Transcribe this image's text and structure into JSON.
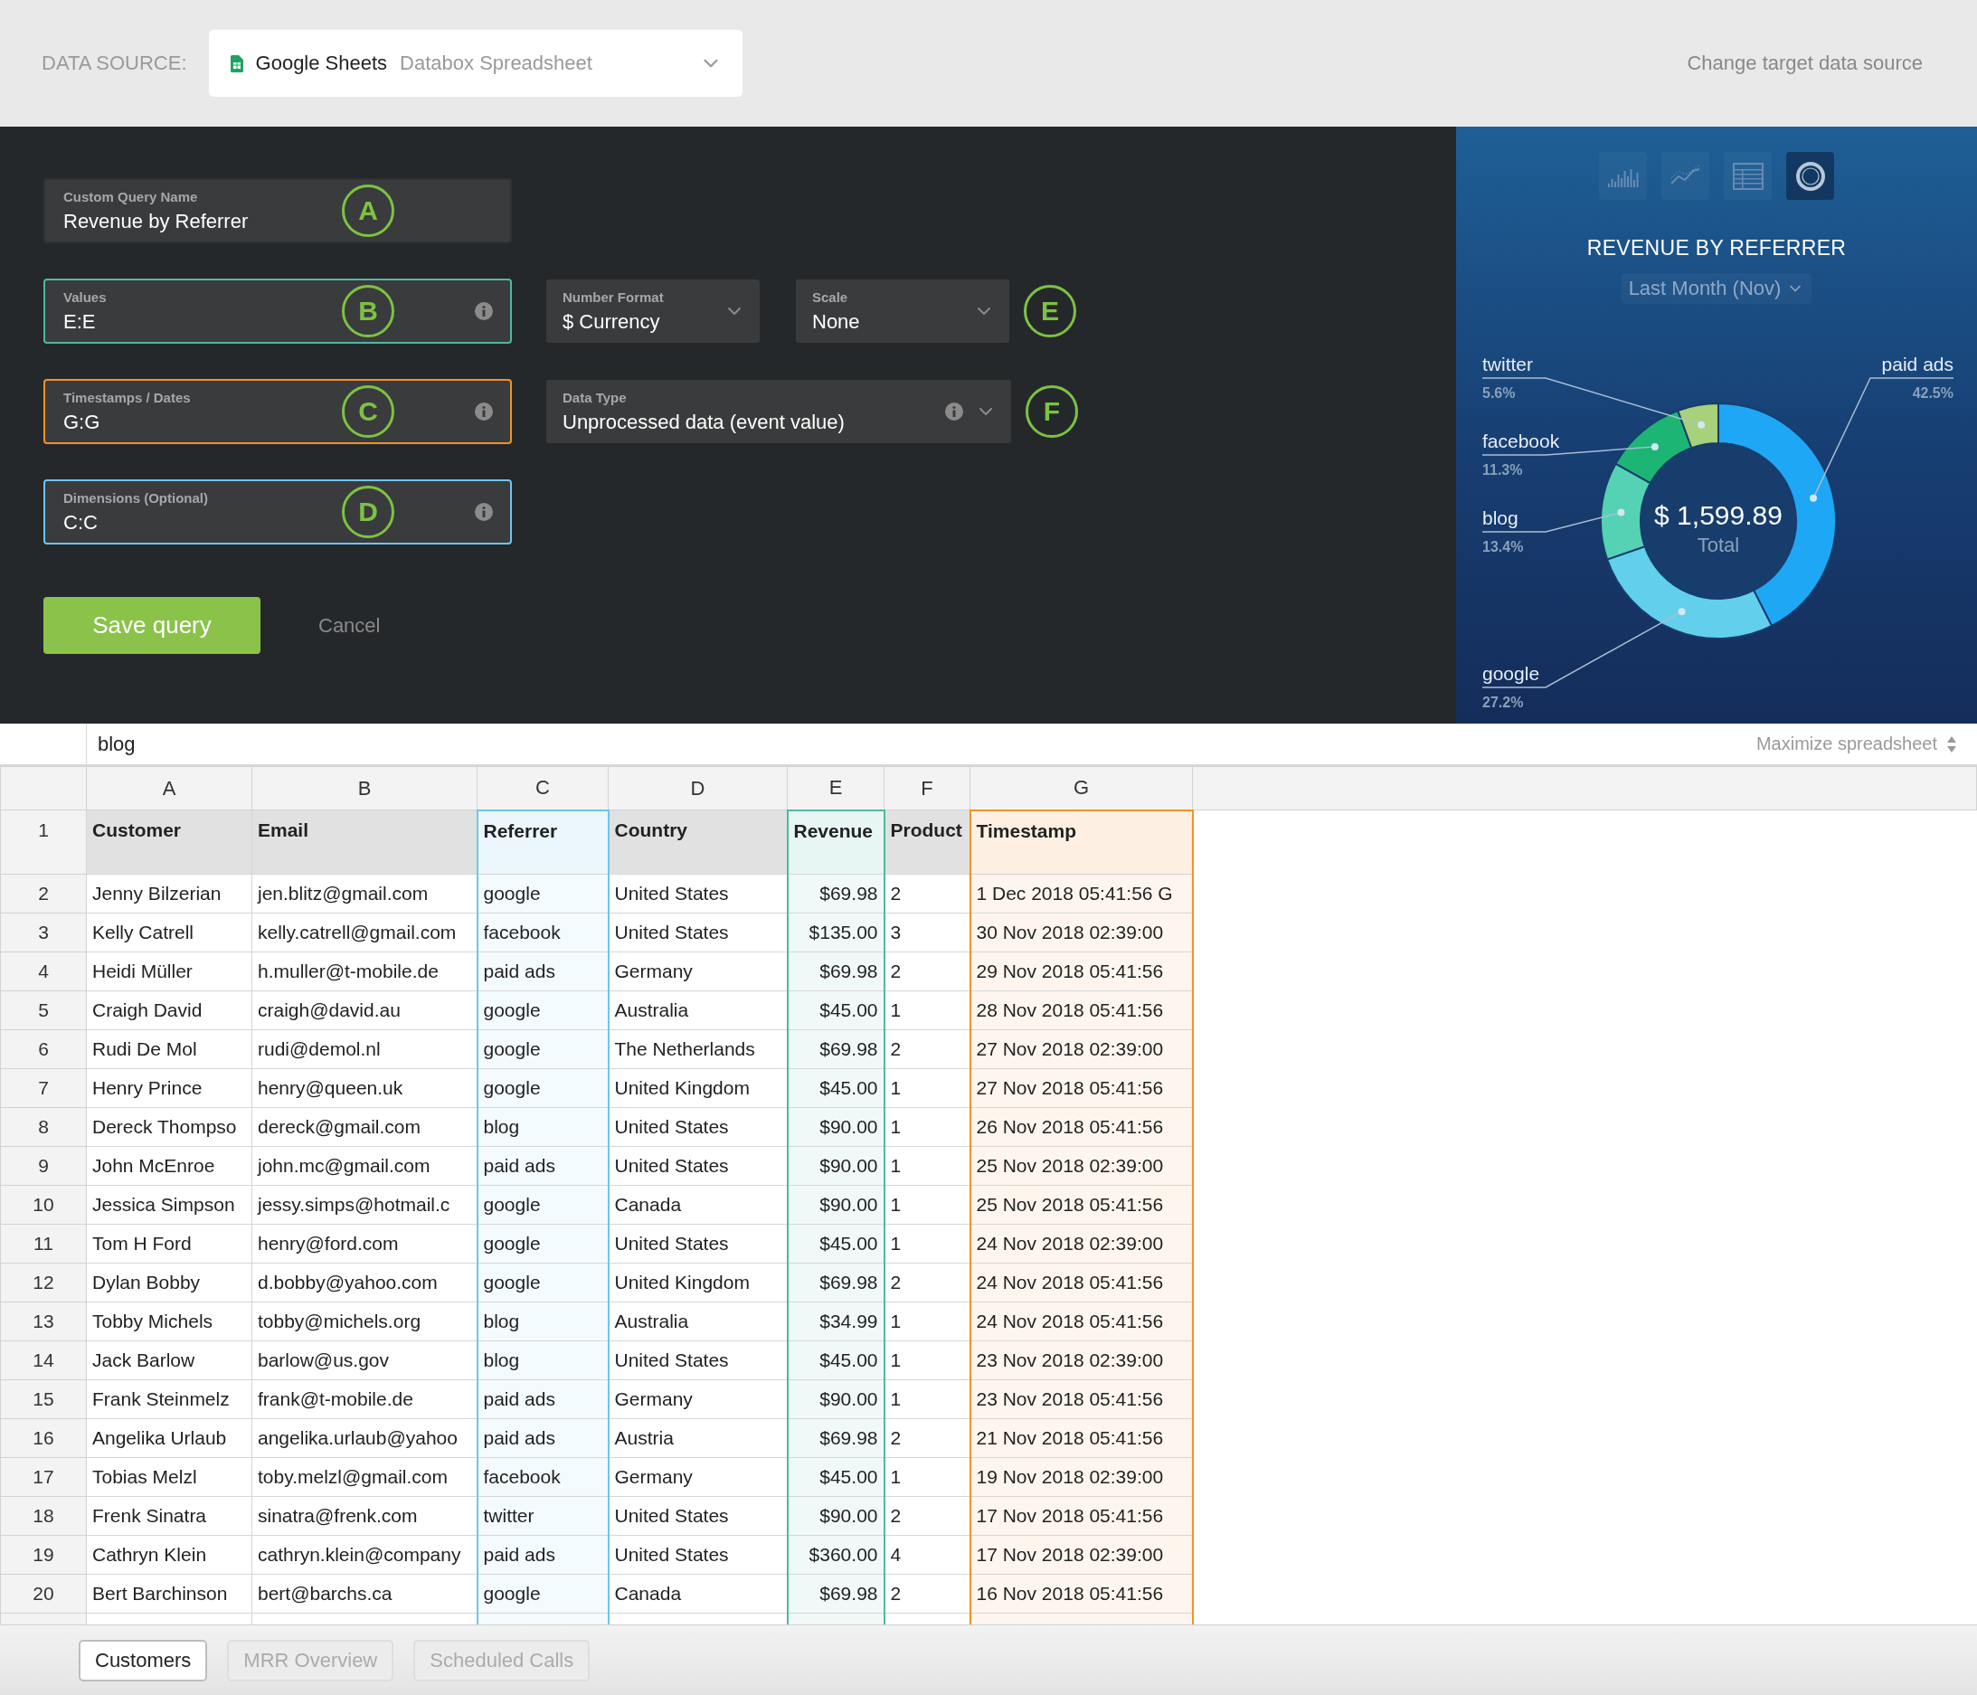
{
  "header": {
    "label": "DATA SOURCE:",
    "source": {
      "name": "Google Sheets",
      "detail": "Databox Spreadsheet"
    },
    "link": "Change target data source"
  },
  "query_form": {
    "rows": [
      {
        "field": {
          "label": "Custom Query Name",
          "value": "Revenue by Referrer",
          "marker": "A",
          "info": false
        }
      },
      {
        "field": {
          "label": "Values",
          "value": "E:E",
          "marker": "B",
          "info": true,
          "color": "#4fb8a2"
        },
        "selects": [
          {
            "label": "Number Format",
            "value": "$ Currency",
            "info": false,
            "wide": false
          },
          {
            "label": "Scale",
            "value": "None",
            "info": false,
            "wide": false
          }
        ],
        "marker": "E"
      },
      {
        "field": {
          "label": "Timestamps / Dates",
          "value": "G:G",
          "marker": "C",
          "info": true,
          "color": "#f0922b"
        },
        "selects": [
          {
            "label": "Data Type",
            "value": "Unprocessed data (event value)",
            "info": true,
            "wide": true
          }
        ],
        "marker": "F"
      },
      {
        "field": {
          "label": "Dimensions (Optional)",
          "value": "C:C",
          "marker": "D",
          "info": true,
          "color": "#6cc6ee"
        }
      }
    ],
    "save": "Save query",
    "cancel": "Cancel"
  },
  "preview": {
    "chart_types": [
      {
        "kind": "bar",
        "selected": false
      },
      {
        "kind": "line",
        "selected": false
      },
      {
        "kind": "table",
        "selected": false
      },
      {
        "kind": "donut",
        "selected": true
      }
    ],
    "period": "Last Month (Nov)",
    "total": "$ 1,599.89",
    "total_label": "Total",
    "chart_data": {
      "type": "donut",
      "title": "REVENUE BY REFERRER",
      "categories": [
        "paid ads",
        "google",
        "blog",
        "facebook",
        "twitter"
      ],
      "values": [
        42.5,
        27.2,
        13.4,
        11.3,
        5.6
      ],
      "value_labels": [
        "42.5%",
        "27.2%",
        "13.4%",
        "11.3%",
        "5.6%"
      ]
    }
  },
  "spreadsheet": {
    "formula": "blog",
    "maximize": "Maximize spreadsheet",
    "columns": [
      {
        "letter": "A"
      },
      {
        "letter": "B"
      },
      {
        "letter": "C",
        "color": "#6cc6ee"
      },
      {
        "letter": "D"
      },
      {
        "letter": "E",
        "color": "#4fb8a2"
      },
      {
        "letter": "F"
      },
      {
        "letter": "G",
        "color": "#f0922b"
      }
    ],
    "header_row": {
      "number": "1",
      "cells": [
        "Customer",
        "Email",
        "Referrer",
        "Country",
        "Revenue",
        "Product",
        "Timestamp"
      ]
    },
    "rows": [
      {
        "number": "2",
        "cells": [
          "Jenny Bilzerian",
          "jen.blitz@gmail.com",
          "google",
          "United States",
          "$69.98",
          "2",
          "1 Dec 2018 05:41:56 G"
        ]
      },
      {
        "number": "3",
        "cells": [
          "Kelly Catrell",
          "kelly.catrell@gmail.com",
          "facebook",
          "United States",
          "$135.00",
          "3",
          "30 Nov 2018 02:39:00"
        ]
      },
      {
        "number": "4",
        "cells": [
          "Heidi Müller",
          "h.muller@t-mobile.de",
          "paid ads",
          "Germany",
          "$69.98",
          "2",
          "29 Nov 2018 05:41:56"
        ]
      },
      {
        "number": "5",
        "cells": [
          "Craigh David",
          "craigh@david.au",
          "google",
          "Australia",
          "$45.00",
          "1",
          "28 Nov 2018 05:41:56"
        ]
      },
      {
        "number": "6",
        "cells": [
          "Rudi De Mol",
          "rudi@demol.nl",
          "google",
          "The Netherlands",
          "$69.98",
          "2",
          "27 Nov 2018 02:39:00"
        ]
      },
      {
        "number": "7",
        "cells": [
          "Henry Prince",
          "henry@queen.uk",
          "google",
          "United Kingdom",
          "$45.00",
          "1",
          "27 Nov 2018 05:41:56"
        ]
      },
      {
        "number": "8",
        "cells": [
          "Dereck Thompso",
          "dereck@gmail.com",
          "blog",
          "United States",
          "$90.00",
          "1",
          "26 Nov 2018 05:41:56"
        ]
      },
      {
        "number": "9",
        "cells": [
          "John McEnroe",
          "john.mc@gmail.com",
          "paid ads",
          "United States",
          "$90.00",
          "1",
          "25 Nov 2018 02:39:00"
        ]
      },
      {
        "number": "10",
        "cells": [
          "Jessica Simpson",
          "jessy.simps@hotmail.c",
          "google",
          "Canada",
          "$90.00",
          "1",
          "25 Nov 2018 05:41:56"
        ]
      },
      {
        "number": "11",
        "cells": [
          "Tom H Ford",
          "henry@ford.com",
          "google",
          "United States",
          "$45.00",
          "1",
          "24 Nov 2018 02:39:00"
        ]
      },
      {
        "number": "12",
        "cells": [
          "Dylan Bobby",
          "d.bobby@yahoo.com",
          "google",
          "United Kingdom",
          "$69.98",
          "2",
          "24 Nov 2018 05:41:56"
        ]
      },
      {
        "number": "13",
        "cells": [
          "Tobby Michels",
          "tobby@michels.org",
          "blog",
          "Australia",
          "$34.99",
          "1",
          "24 Nov 2018 05:41:56"
        ]
      },
      {
        "number": "14",
        "cells": [
          "Jack Barlow",
          "barlow@us.gov",
          "blog",
          "United States",
          "$45.00",
          "1",
          "23 Nov 2018 02:39:00"
        ]
      },
      {
        "number": "15",
        "cells": [
          "Frank Steinmelz",
          "frank@t-mobile.de",
          "paid ads",
          "Germany",
          "$90.00",
          "1",
          "23 Nov 2018 05:41:56"
        ]
      },
      {
        "number": "16",
        "cells": [
          "Angelika Urlaub",
          "angelika.urlaub@yahoo",
          "paid ads",
          "Austria",
          "$69.98",
          "2",
          "21 Nov 2018 05:41:56"
        ]
      },
      {
        "number": "17",
        "cells": [
          "Tobias Melzl",
          "toby.melzl@gmail.com",
          "facebook",
          "Germany",
          "$45.00",
          "1",
          "19 Nov 2018 02:39:00"
        ]
      },
      {
        "number": "18",
        "cells": [
          "Frenk Sinatra",
          "sinatra@frenk.com",
          "twitter",
          "United States",
          "$90.00",
          "2",
          "17 Nov 2018 05:41:56"
        ]
      },
      {
        "number": "19",
        "cells": [
          "Cathryn Klein",
          "cathryn.klein@company",
          "paid ads",
          "United States",
          "$360.00",
          "4",
          "17 Nov 2018 02:39:00"
        ]
      },
      {
        "number": "20",
        "cells": [
          "Bert Barchinson",
          "bert@barchs.ca",
          "google",
          "Canada",
          "$69.98",
          "2",
          "16 Nov 2018 05:41:56"
        ]
      }
    ],
    "tabs": [
      {
        "label": "Customers",
        "selected": true
      },
      {
        "label": "MRR Overview",
        "selected": false
      },
      {
        "label": "Scheduled Calls",
        "selected": false
      }
    ]
  }
}
